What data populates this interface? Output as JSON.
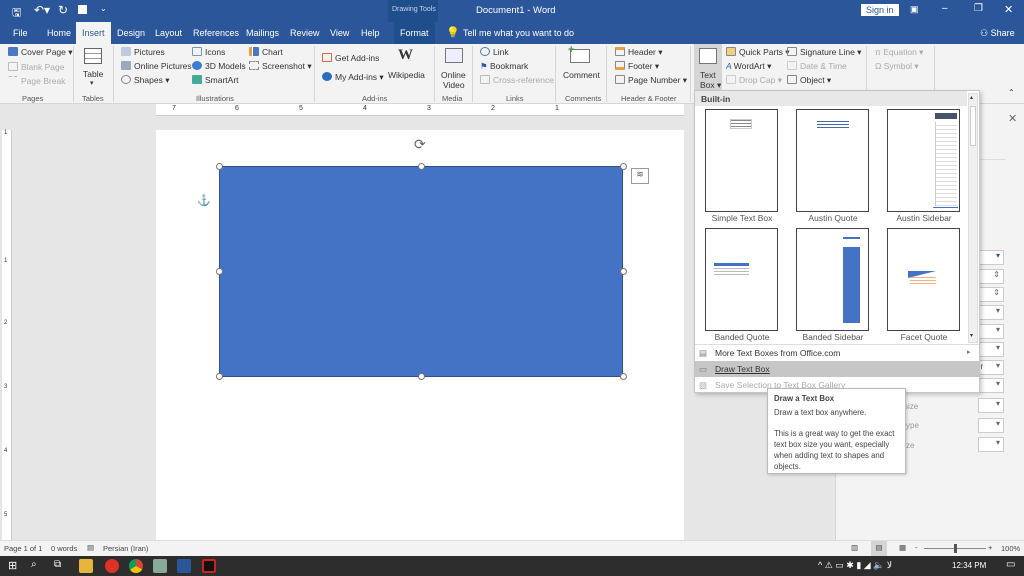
{
  "title_bar": {
    "document_title": "Document1  -  Word",
    "contextual_group": "Drawing Tools",
    "sign_in": "Sign in"
  },
  "tabs": [
    "File",
    "Home",
    "Insert",
    "Design",
    "Layout",
    "References",
    "Mailings",
    "Review",
    "View",
    "Help",
    "Format"
  ],
  "active_tab": "Insert",
  "tell_me": "Tell me what you want to do",
  "share": "Share",
  "ribbon": {
    "pages": {
      "label": "Pages",
      "items": [
        "Cover Page ▾",
        "Blank Page",
        "Page Break"
      ]
    },
    "tables": {
      "label": "Tables",
      "items": [
        "Table"
      ]
    },
    "illustrations": {
      "label": "Illustrations",
      "items": [
        "Pictures",
        "Online Pictures",
        "Shapes ▾",
        "Icons",
        "3D Models",
        "SmartArt",
        "Chart",
        "Screenshot ▾"
      ]
    },
    "addins": {
      "label": "Add-ins",
      "items": [
        "Get Add-ins",
        "My Add-ins ▾",
        "Wikipedia"
      ]
    },
    "media": {
      "label": "Media",
      "items": [
        "Online",
        "Video"
      ]
    },
    "links": {
      "label": "Links",
      "items": [
        "Link",
        "Bookmark",
        "Cross-reference"
      ]
    },
    "comments": {
      "label": "Comments",
      "items": [
        "Comment"
      ]
    },
    "header_footer": {
      "label": "Header & Footer",
      "items": [
        "Header ▾",
        "Footer ▾",
        "Page Number ▾"
      ]
    },
    "text": {
      "items": [
        "Text",
        "Box ▾",
        "Quick Parts ▾",
        "WordArt ▾",
        "Drop Cap ▾",
        "Signature Line ▾",
        "Date & Time",
        "Object ▾"
      ]
    },
    "symbols": {
      "items": [
        "Equation ▾",
        "Symbol ▾"
      ]
    }
  },
  "ruler_numbers": [
    "7",
    "6",
    "5",
    "4",
    "3",
    "2",
    "1"
  ],
  "vruler_numbers": [
    "1",
    "1",
    "2",
    "3",
    "4",
    "5"
  ],
  "textbox_gallery": {
    "section": "Built-in",
    "items": [
      "Simple Text Box",
      "Austin Quote",
      "Austin Sidebar",
      "Banded Quote",
      "Banded Sidebar",
      "Facet Quote"
    ],
    "menu": [
      "More Text Boxes from Office.com",
      "Draw Text Box",
      "Save Selection to Text Box Gallery"
    ],
    "highlighted": "Draw Text Box"
  },
  "tooltip": {
    "title": "Draw a Text Box",
    "line1": "Draw a text box anywhere.",
    "line2": "This is a great way to get the exact text box size you want, especially when adding text to shapes and objects."
  },
  "pane_fragments": [
    "er",
    "size",
    "ype",
    "ze"
  ],
  "status_bar": {
    "page": "Page 1 of 1",
    "words": "0 words",
    "language": "Persian (Iran)",
    "zoom": "100%",
    "zoom_level": 1.0
  },
  "taskbar": {
    "time": "12:34 PM"
  },
  "colors": {
    "brand": "#2b579a",
    "shape_fill": "#4472c4"
  }
}
